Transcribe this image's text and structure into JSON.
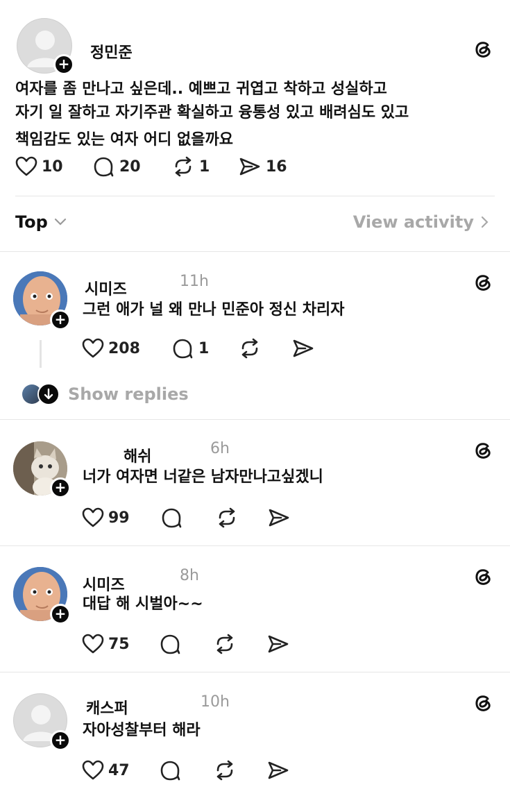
{
  "post": {
    "author": "정민준",
    "lines": [
      "여자를 좀 만나고 싶은데.. 예쁘고 귀엽고 착하고 성실하고",
      "자기 일 잘하고 자기주관 확실하고 융통성 있고 배려심도 있고",
      "책임감도 있는 여자 어디 없을까요"
    ],
    "likes": "10",
    "comments": "20",
    "reposts": "1",
    "shares": "16"
  },
  "sort_bar": {
    "sort_label": "Top",
    "activity_label": "View activity"
  },
  "replies": [
    {
      "author": "시미즈",
      "time": "11h",
      "text": "그런 애가 널 왜 만나 민준아 정신 차리자",
      "likes": "208",
      "comments": "1",
      "avatar": "baby-face"
    },
    {
      "author": "해쉬",
      "time": "6h",
      "text": "너가 여자면 너같은 남자만나고싶겠니",
      "likes": "99",
      "comments": "",
      "avatar": "cat"
    },
    {
      "author": "시미즈",
      "time": "8h",
      "text": "대답 해 시벌아~~",
      "likes": "75",
      "comments": "",
      "avatar": "baby-face"
    },
    {
      "author": "캐스퍼",
      "time": "10h",
      "text": "자아성찰부터 해라",
      "likes": "47",
      "comments": "",
      "avatar": "default"
    }
  ],
  "show_replies_label": "Show replies",
  "colors": {
    "text": "#111111",
    "muted": "#9a9a9a",
    "divider": "#e6e6e6",
    "badge": "#0a0a0a"
  },
  "icons": [
    "heart-icon",
    "comment-icon",
    "repost-icon",
    "share-icon",
    "threads-icon",
    "plus-icon",
    "chevron-down-icon",
    "chevron-right-icon",
    "arrow-down-icon"
  ]
}
